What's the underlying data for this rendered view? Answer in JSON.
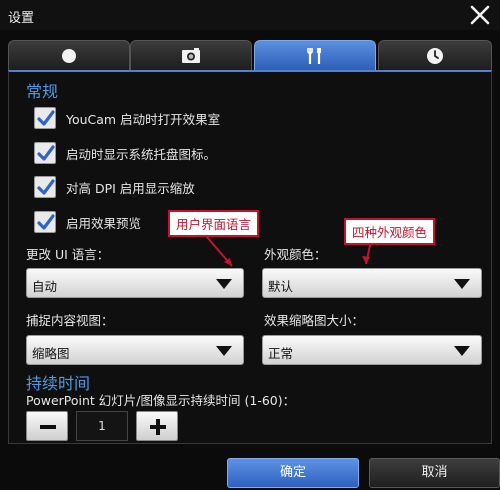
{
  "window": {
    "title": "设置"
  },
  "tabs": [
    {
      "icon": "record-icon",
      "active": false
    },
    {
      "icon": "camera-icon",
      "active": false
    },
    {
      "icon": "tools-icon",
      "active": true
    },
    {
      "icon": "clock-icon",
      "active": false
    }
  ],
  "general": {
    "title": "常规",
    "options": [
      {
        "label": "YouCam 启动时打开效果室",
        "checked": true
      },
      {
        "label": "启动时显示系统托盘图标。",
        "checked": true
      },
      {
        "label": "对高 DPI 启用显示缩放",
        "checked": true
      },
      {
        "label": "启用效果预览",
        "checked": true
      }
    ]
  },
  "fields": {
    "ui_language": {
      "label": "更改 UI 语言：",
      "value": "自动"
    },
    "appearance_color": {
      "label": "外观颜色：",
      "value": "默认"
    },
    "capture_view": {
      "label": "捕捉内容视图：",
      "value": "缩略图"
    },
    "thumbnail_size": {
      "label": "效果缩略图大小：",
      "value": "正常"
    }
  },
  "annotations": {
    "ui_language": "用户界面语言",
    "colors": "四种外观颜色"
  },
  "duration": {
    "title": "持续时间",
    "label": "PowerPoint 幻灯片/图像显示持续时间 (1-60)：",
    "value": "1"
  },
  "buttons": {
    "ok": "确定",
    "cancel": "取消"
  },
  "colors": {
    "accent": "#4f9ae6",
    "active_tab": "#3f74cf",
    "callout": "#c4122f"
  }
}
